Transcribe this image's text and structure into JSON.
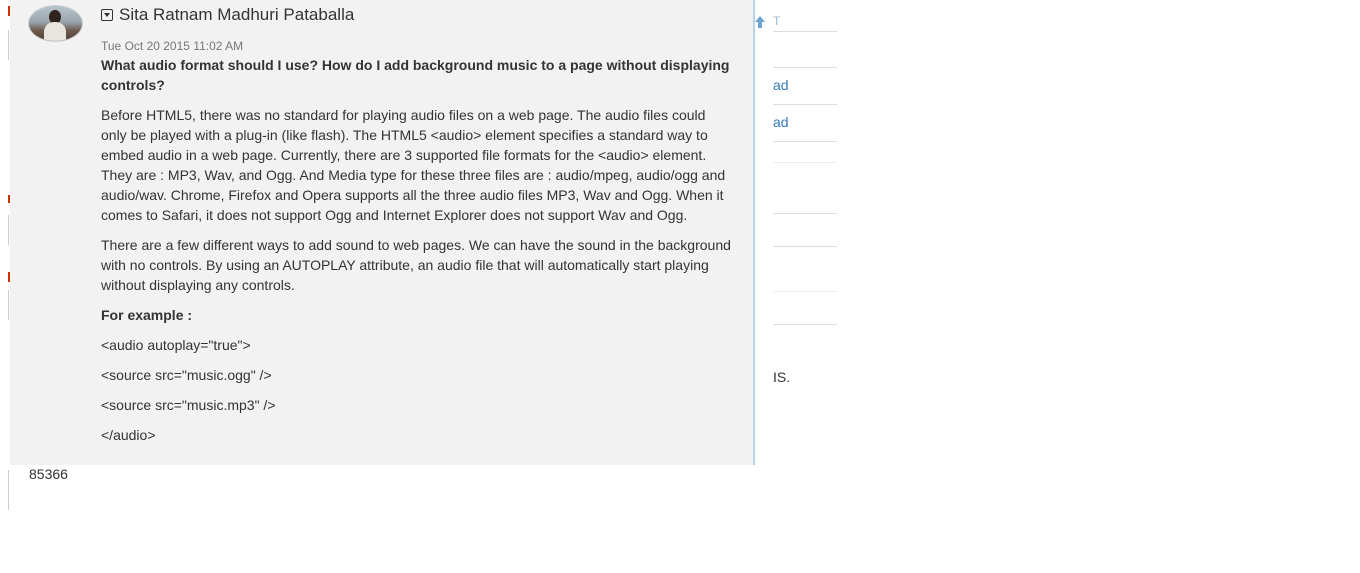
{
  "post": {
    "author": "Sita Ratnam Madhuri Pataballa",
    "timestamp": "Tue Oct 20 2015 11:02 AM",
    "question": "What audio format should I use? How do I add background music to a page without displaying controls?",
    "paragraph1": "Before HTML5, there was no standard for playing audio files on a web page. The audio files could only be played with a plug-in (like flash). The HTML5 <audio> element specifies a standard way to embed audio in a web page. Currently, there are 3 supported file formats for the <audio> element. They are : MP3, Wav, and Ogg. And Media type for these three files are : audio/mpeg, audio/ogg and audio/wav. Chrome, Firefox and Opera supports all the three audio files MP3, Wav and Ogg. When it comes to Safari, it does not support Ogg and Internet Explorer does not support Wav and Ogg.",
    "paragraph2": "There are a few different ways to add sound to web pages. We can have the sound in the background with no controls. By using an AUTOPLAY attribute, an audio file that will automatically start playing without displaying any controls.",
    "example_label": "For example :",
    "code_lines": [
      "<audio autoplay=\"true\">",
      "<source src=\"music.ogg\" />",
      "<source src=\"music.mp3\" />",
      "</audio>"
    ],
    "post_id": "85366"
  },
  "right_column": {
    "tiny_text": "T",
    "link1": "ad",
    "link2": "ad",
    "trailing_text": "IS."
  },
  "icons": {
    "toggle": "collapse-toggle-icon",
    "upvote": "arrow-up-icon",
    "avatar": "user-avatar"
  },
  "colors": {
    "card_background": "#f2f2f2",
    "link": "#337ab7",
    "accent_border": "#b9d3ea"
  }
}
